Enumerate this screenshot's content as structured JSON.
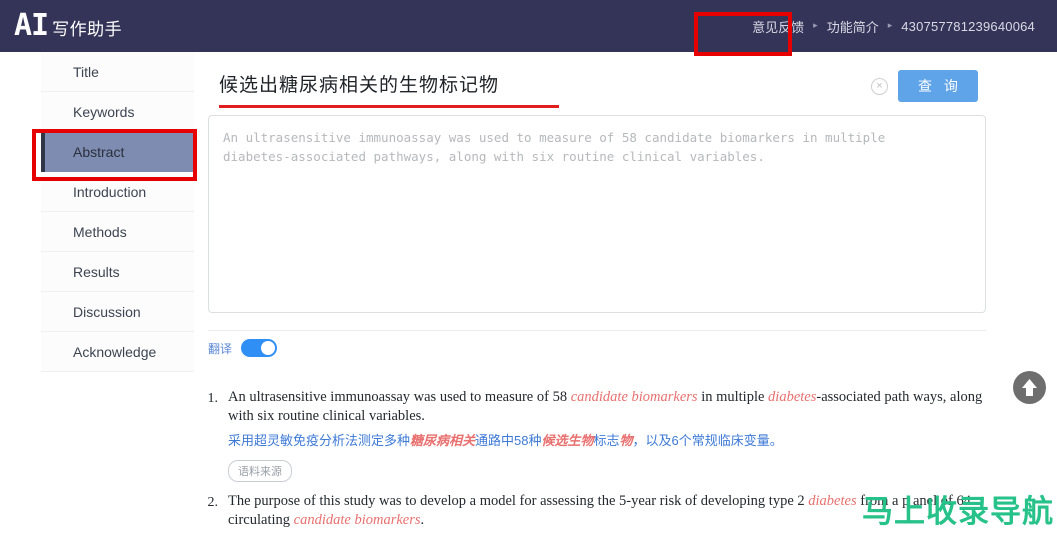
{
  "header": {
    "logo_main": "AI",
    "logo_sub": "写作助手",
    "nav": [
      {
        "label": "意见反馈"
      },
      {
        "label": "功能简介"
      }
    ],
    "separator": "▸",
    "user_id": "430757781239640064"
  },
  "sidebar": {
    "items": [
      {
        "label": "Title",
        "active": false
      },
      {
        "label": "Keywords",
        "active": false
      },
      {
        "label": "Abstract",
        "active": true
      },
      {
        "label": "Introduction",
        "active": false
      },
      {
        "label": "Methods",
        "active": false
      },
      {
        "label": "Results",
        "active": false
      },
      {
        "label": "Discussion",
        "active": false
      },
      {
        "label": "Acknowledge",
        "active": false
      }
    ]
  },
  "search": {
    "value": "候选出糖尿病相关的生物标记物",
    "clear_icon": "×",
    "button_label": "查 询"
  },
  "editor": {
    "placeholder": "An ultrasensitive immunoassay was used to measure of 58 candidate biomarkers in multiple\ndiabetes-associated pathways, along with six routine clinical variables.",
    "value": ""
  },
  "translate": {
    "label": "翻译",
    "enabled": true
  },
  "results": [
    {
      "number": "1.",
      "english_html": "An ultrasensitive immunoassay was used to measure of 58 <em>candidate biomarkers</em> in multiple <em>diabetes</em>-associated path ways, along with six routine clinical variables.",
      "chinese_html": "采用超灵敏免疫分析法测定多种<em>糖尿病相关</em>通路中58种<em>候选生物</em>标志<em>物</em>，以及6个常规临床变量。",
      "source_tag": "语料来源"
    },
    {
      "number": "2.",
      "english_html": "The purpose of this study was to develop a model for assessing the 5-year risk of developing type 2 <em>diabetes</em> from a p anel of 64 circulating <em>candidate biomarkers</em>.",
      "chinese_html": "",
      "source_tag": ""
    }
  ],
  "back_to_top": {
    "icon": "arrow-up"
  },
  "watermark": {
    "text": "马上收录导航"
  },
  "colors": {
    "header_bg": "#343459",
    "accent_blue": "#5fa4e8",
    "annotation_red": "#e60000",
    "highlight_red": "#e8706f",
    "translation_blue": "#3d7ad6",
    "sidebar_active_bg": "#7d8cb0",
    "watermark_green": "#27c28a"
  }
}
